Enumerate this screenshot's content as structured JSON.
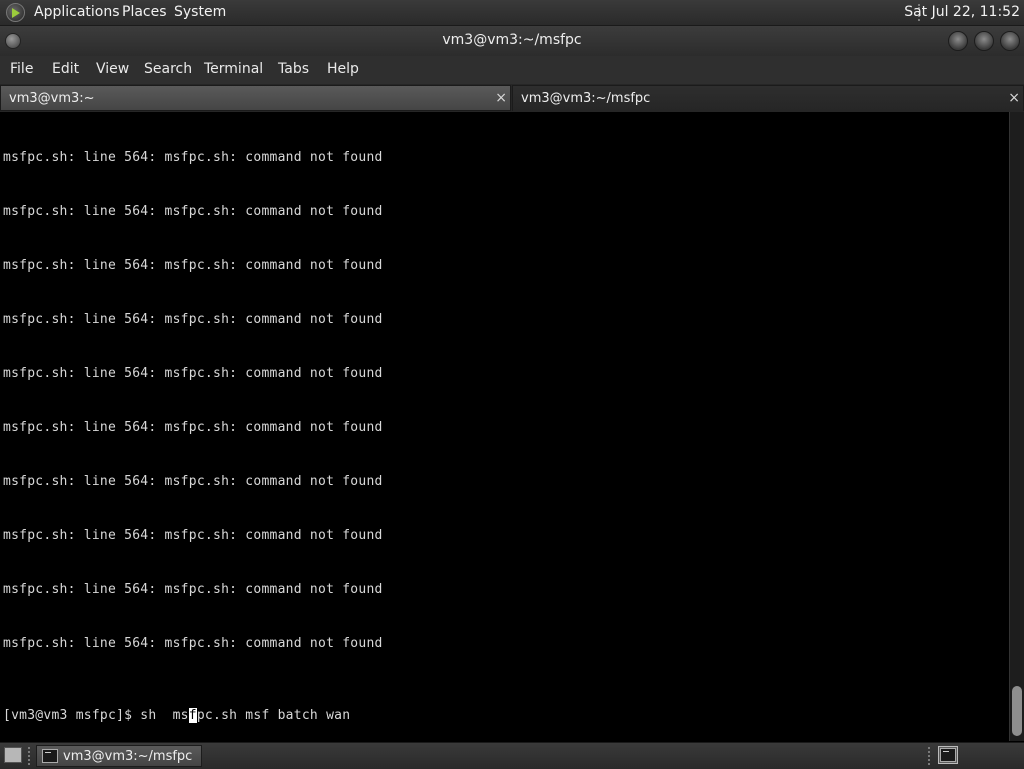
{
  "top_panel": {
    "menus": [
      "Applications",
      "Places",
      "System"
    ],
    "clock": "Sat Jul 22, 11:52"
  },
  "window": {
    "title": "vm3@vm3:~/msfpc"
  },
  "menubar": [
    "File",
    "Edit",
    "View",
    "Search",
    "Terminal",
    "Tabs",
    "Help"
  ],
  "tabs": [
    {
      "label": "vm3@vm3:~",
      "close": "×"
    },
    {
      "label": "vm3@vm3:~/msfpc",
      "close": "×"
    }
  ],
  "terminal": {
    "output_lines": [
      "msfpc.sh: line 564: msfpc.sh: command not found",
      "msfpc.sh: line 564: msfpc.sh: command not found",
      "msfpc.sh: line 564: msfpc.sh: command not found",
      "msfpc.sh: line 564: msfpc.sh: command not found",
      "msfpc.sh: line 564: msfpc.sh: command not found",
      "msfpc.sh: line 564: msfpc.sh: command not found",
      "msfpc.sh: line 564: msfpc.sh: command not found",
      "msfpc.sh: line 564: msfpc.sh: command not found",
      "msfpc.sh: line 564: msfpc.sh: command not found",
      "msfpc.sh: line 564: msfpc.sh: command not found"
    ],
    "prompt": {
      "before_cursor": "[vm3@vm3 msfpc]$ sh  ms",
      "cursor_char": "f",
      "after_cursor": "pc.sh msf batch wan"
    }
  },
  "bottom_panel": {
    "task_label": "vm3@vm3:~/msfpc"
  },
  "icons": {
    "apps_logo": "gnome-foot-icon",
    "terminal": "terminal-icon",
    "show_desktop": "show-desktop-icon"
  }
}
